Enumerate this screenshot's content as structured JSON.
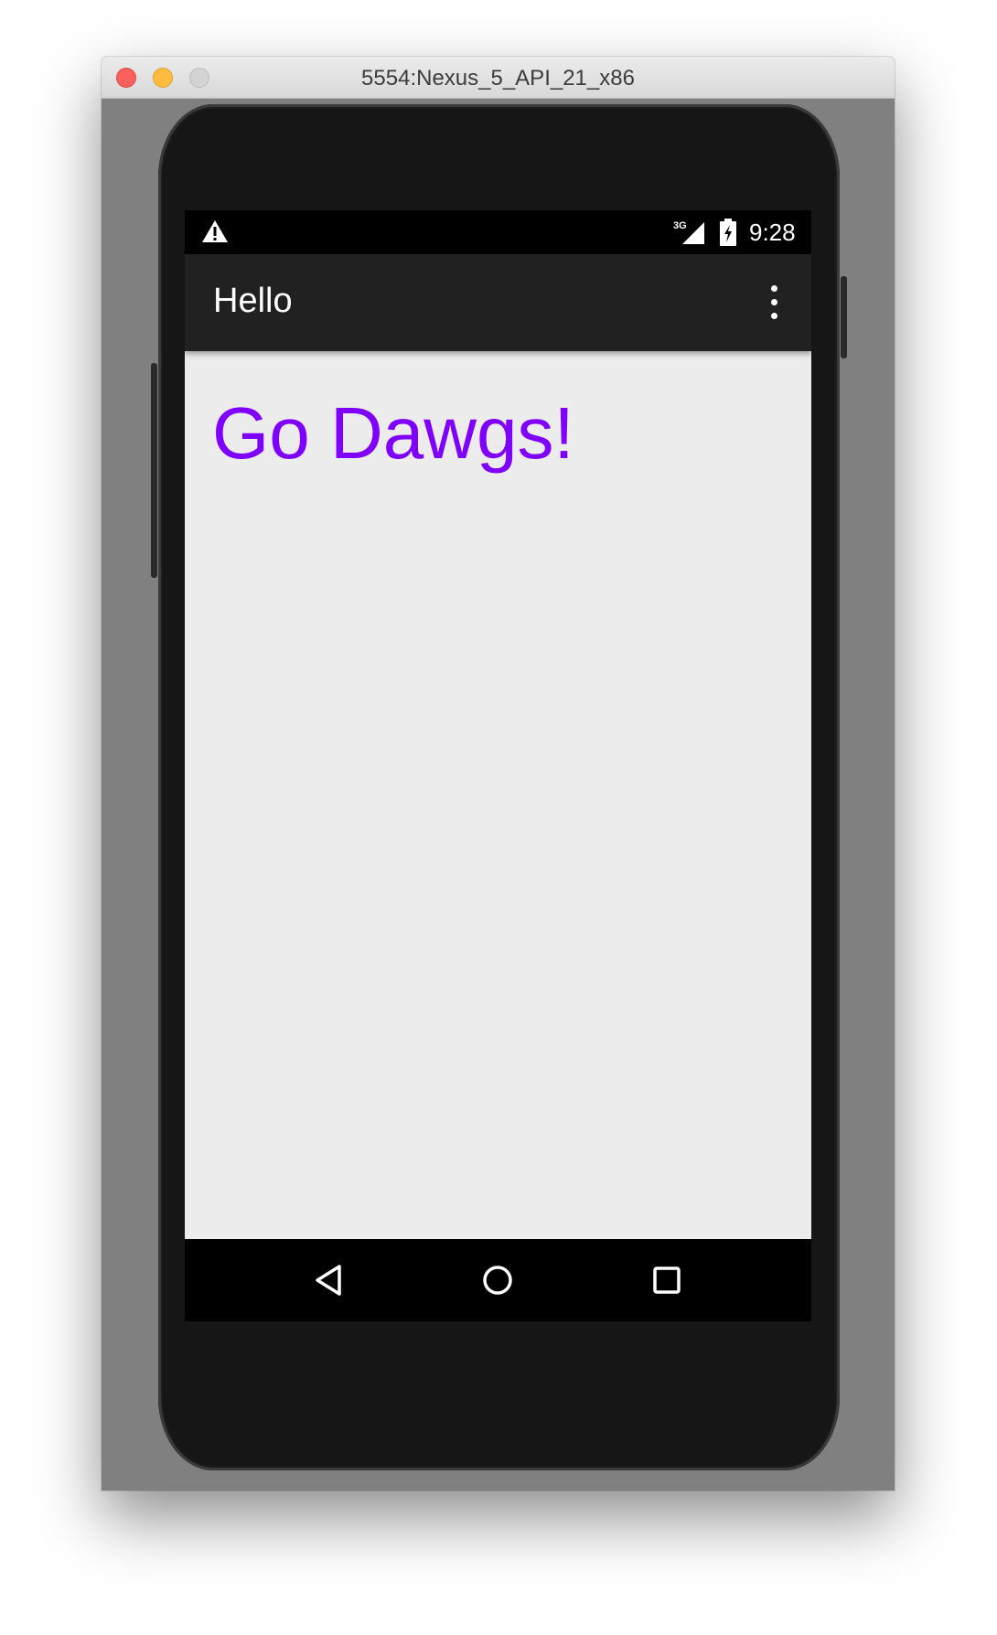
{
  "window": {
    "title": "5554:Nexus_5_API_21_x86"
  },
  "statusbar": {
    "warning_icon": "warning-triangle-icon",
    "signal_label": "3G",
    "signal_icon": "cell-signal-icon",
    "battery_icon": "battery-charging-icon",
    "time": "9:28"
  },
  "actionbar": {
    "title": "Hello",
    "overflow_icon": "more-vert-icon"
  },
  "content": {
    "text": "Go Dawgs!"
  },
  "navbar": {
    "back_icon": "back-triangle-icon",
    "home_icon": "home-circle-icon",
    "recents_icon": "recents-square-icon"
  },
  "colors": {
    "greeting_text": "#7f00ff",
    "actionbar_bg": "#212121",
    "screen_bg": "#ececec",
    "statusbar_bg": "#000000",
    "navbar_bg": "#000000",
    "emulator_frame": "#808080"
  }
}
